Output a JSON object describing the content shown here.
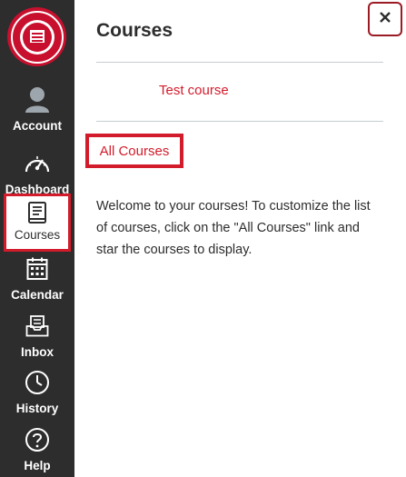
{
  "nav": {
    "logo_icon": "university-seal-icon",
    "items": [
      {
        "label": "Account",
        "icon": "user-avatar-icon"
      },
      {
        "label": "Dashboard",
        "icon": "speedometer-icon"
      },
      {
        "label": "Courses",
        "icon": "book-icon"
      },
      {
        "label": "Calendar",
        "icon": "calendar-icon"
      },
      {
        "label": "Inbox",
        "icon": "inbox-icon"
      },
      {
        "label": "History",
        "icon": "clock-icon"
      },
      {
        "label": "Help",
        "icon": "help-icon"
      }
    ]
  },
  "tray": {
    "title": "Courses",
    "close_icon": "close-icon",
    "courses": [
      "Test course"
    ],
    "all_courses_label": "All Courses",
    "welcome_text": "Welcome to your courses! To customize the list of courses, click on the \"All Courses\" link and star the courses to display."
  },
  "colors": {
    "nav_bg": "#2d2d2d",
    "accent": "#d21c2c",
    "close_border": "#9b1b24",
    "logo_red": "#c8102e"
  }
}
